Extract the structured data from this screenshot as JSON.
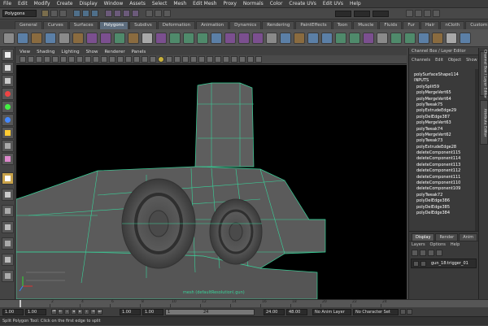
{
  "menubar": {
    "items": [
      "File",
      "Edit",
      "Modify",
      "Create",
      "Display",
      "Window",
      "Assets",
      "Select",
      "Mesh",
      "Edit Mesh",
      "Proxy",
      "Normals",
      "Color",
      "Create UVs",
      "Edit UVs",
      "Help"
    ]
  },
  "statusline": {
    "mode": "Polygons"
  },
  "shelf": {
    "tabs": [
      "General",
      "Curves",
      "Surfaces",
      "Polygons",
      "Subdivs",
      "Deformation",
      "Animation",
      "Dynamics",
      "Rendering",
      "PaintEffects",
      "Toon",
      "Muscle",
      "Fluids",
      "Fur",
      "Hair",
      "nCloth",
      "Custom"
    ],
    "active_tab": "Polygons"
  },
  "toolbox": {
    "tools": [
      "select-tool",
      "lasso-tool",
      "paint-select-tool",
      "move-tool",
      "rotate-tool",
      "scale-tool",
      "universal-manipulator-tool",
      "soft-modification-tool",
      "show-manipulator-tool",
      "current-tool-split-polygon",
      "single-perspective-layout",
      "four-view-layout",
      "persp-outliner-layout",
      "persp-graph-layout",
      "persp-hypergraph-layout",
      "outliner-layout"
    ]
  },
  "viewport": {
    "menu": [
      "View",
      "Shading",
      "Lighting",
      "Show",
      "Renderer",
      "Panels"
    ],
    "hud_label": "mesh (defaultResolution\\ gun)",
    "colors": {
      "background": "#000000",
      "mesh": "#5a5a5a",
      "wire": "#39d39a"
    }
  },
  "channel_box": {
    "title": "Channel Box / Layer Editor",
    "menu": [
      "Channels",
      "Edit",
      "Object",
      "Show"
    ],
    "shape_node": "polySurfaceShape114",
    "inputs_header": "INPUTS",
    "inputs": [
      "polySplit59",
      "polyMergeVert65",
      "polyMergeVert64",
      "polyTweak75",
      "polyExtrudeEdge29",
      "polyDelEdge387",
      "polyMergeVert63",
      "polyTweak74",
      "polyMergeVert62",
      "polyTweak73",
      "polyExtrudeEdge28",
      "deleteComponent115",
      "deleteComponent114",
      "deleteComponent113",
      "deleteComponent112",
      "deleteComponent111",
      "deleteComponent110",
      "deleteComponent109",
      "polyTweak72",
      "polyDelEdge386",
      "polyDelEdge385",
      "polyDelEdge384"
    ]
  },
  "side_tabs": [
    "Channel Box / Layer Editor",
    "Attribute Editor"
  ],
  "layer_editor": {
    "tabs": [
      "Display",
      "Render",
      "Anim"
    ],
    "active_tab": "Display",
    "menu": [
      "Layers",
      "Options",
      "Help"
    ],
    "layers": [
      {
        "name": "gun_18:trigger_01"
      }
    ]
  },
  "timeslider": {
    "ticks": [
      "2",
      "4",
      "6",
      "8",
      "10",
      "12",
      "14",
      "16",
      "18",
      "20",
      "22",
      "24"
    ],
    "current_frame": "1"
  },
  "rangebar": {
    "start": "1.00",
    "playback_start": "1.00",
    "current": "1.00",
    "range_start": "1",
    "range_end": "24",
    "playback_end": "24.00",
    "end": "48.00",
    "anim_layer": "No Anim Layer",
    "character_set": "No Character Set"
  },
  "helpline": {
    "text": "Split Polygon Tool: Click on the first edge to split"
  }
}
